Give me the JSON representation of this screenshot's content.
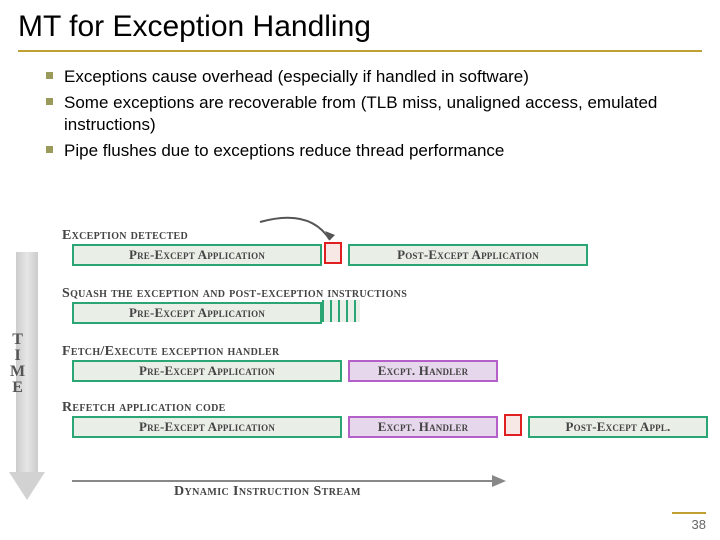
{
  "title": "MT for Exception Handling",
  "bullets": [
    "Exceptions cause overhead (especially if handled in software)",
    "Some exceptions are recoverable from (TLB miss, unaligned access, emulated instructions)",
    "Pipe flushes due to exceptions reduce thread performance"
  ],
  "diagram": {
    "time_axis": "TIME",
    "dynamic_stream": "Dynamic Instruction Stream",
    "stages": [
      {
        "label": "Exception detected",
        "segments": [
          {
            "kind": "pre",
            "text": "Pre-Except Application"
          },
          {
            "kind": "red"
          },
          {
            "kind": "post",
            "text": "Post-Except Application"
          }
        ]
      },
      {
        "label": "Squash the exception and post-exception instructions",
        "segments": [
          {
            "kind": "pre",
            "text": "Pre-Except Application"
          },
          {
            "kind": "stripes"
          }
        ]
      },
      {
        "label": "Fetch/Execute exception handler",
        "segments": [
          {
            "kind": "pre",
            "text": "Pre-Except Application"
          },
          {
            "kind": "handler",
            "text": "Excpt. Handler"
          }
        ]
      },
      {
        "label": "Refetch application code",
        "segments": [
          {
            "kind": "pre",
            "text": "Pre-Except Application"
          },
          {
            "kind": "handler",
            "text": "Excpt. Handler"
          },
          {
            "kind": "red"
          },
          {
            "kind": "post",
            "text": "Post-Except Appl."
          }
        ]
      }
    ]
  },
  "page_number": "38"
}
